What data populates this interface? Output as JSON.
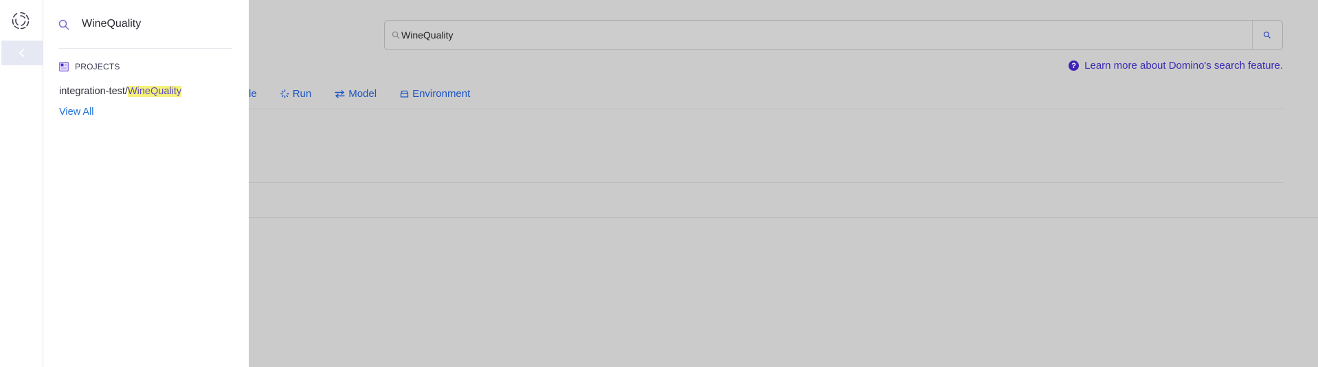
{
  "background": {
    "search": {
      "value": "WineQuality"
    },
    "learn_more": "Learn more about Domino's search feature.",
    "tabs": [
      {
        "label": "le",
        "icon": ""
      },
      {
        "label": "Run",
        "icon": "spinner-icon"
      },
      {
        "label": "Model",
        "icon": "arrows-swap-icon"
      },
      {
        "label": "Environment",
        "icon": "environment-icon"
      }
    ]
  },
  "rail": {
    "collapse_icon": "chevron-left-icon",
    "logo": "domino-logo"
  },
  "panel": {
    "query": "WineQuality",
    "section_title": "PROJECTS",
    "result": {
      "prefix": "integration-test/",
      "match": "WineQuality"
    },
    "view_all": "View All"
  },
  "colors": {
    "accent": "#4124b6",
    "link": "#1d6fd6",
    "highlight": "#f5f17a"
  }
}
